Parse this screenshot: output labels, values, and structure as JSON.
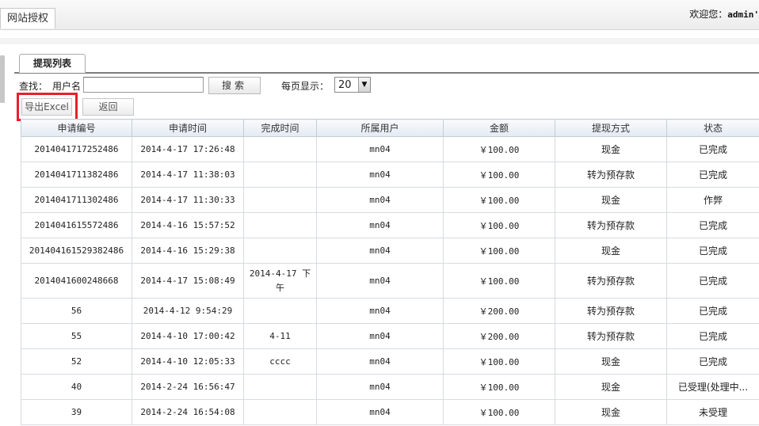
{
  "top": {
    "tab_label": "网站授权",
    "welcome_text": "欢迎您：",
    "welcome_user": "admin'"
  },
  "list_tab": "提现列表",
  "search": {
    "find_label": "查找：",
    "user_label": "用户名",
    "input_value": "",
    "button_label": "搜索",
    "per_page_label": "每页显示：",
    "per_page_value": "20"
  },
  "actions": {
    "export_label": "导出Excel",
    "back_label": "返回"
  },
  "table": {
    "columns": [
      "申请编号",
      "申请时间",
      "完成时间",
      "所属用户",
      "金额",
      "提现方式",
      "状态"
    ],
    "rows": [
      [
        "2014041717252486",
        "2014-4-17 17:26:48",
        "",
        "mn04",
        "￥100.00",
        "现金",
        "已完成"
      ],
      [
        "2014041711382486",
        "2014-4-17 11:38:03",
        "",
        "mn04",
        "￥100.00",
        "转为预存款",
        "已完成"
      ],
      [
        "2014041711302486",
        "2014-4-17 11:30:33",
        "",
        "mn04",
        "￥100.00",
        "现金",
        "作弊"
      ],
      [
        "2014041615572486",
        "2014-4-16 15:57:52",
        "",
        "mn04",
        "￥100.00",
        "转为预存款",
        "已完成"
      ],
      [
        "201404161529382486",
        "2014-4-16 15:29:38",
        "",
        "mn04",
        "￥100.00",
        "现金",
        "已完成"
      ],
      [
        "2014041600248668",
        "2014-4-17 15:08:49",
        "2014-4-17 下午",
        "mn04",
        "￥100.00",
        "转为预存款",
        "已完成"
      ],
      [
        "56",
        "2014-4-12 9:54:29",
        "",
        "mn04",
        "￥200.00",
        "转为预存款",
        "已完成"
      ],
      [
        "55",
        "2014-4-10 17:00:42",
        "4-11",
        "mn04",
        "￥200.00",
        "转为预存款",
        "已完成"
      ],
      [
        "52",
        "2014-4-10 12:05:33",
        "cccc",
        "mn04",
        "￥100.00",
        "现金",
        "已完成"
      ],
      [
        "40",
        "2014-2-24 16:56:47",
        "",
        "mn04",
        "￥100.00",
        "现金",
        "已受理(处理中..."
      ],
      [
        "39",
        "2014-2-24 16:54:08",
        "",
        "mn04",
        "￥100.00",
        "现金",
        "未受理"
      ]
    ]
  }
}
